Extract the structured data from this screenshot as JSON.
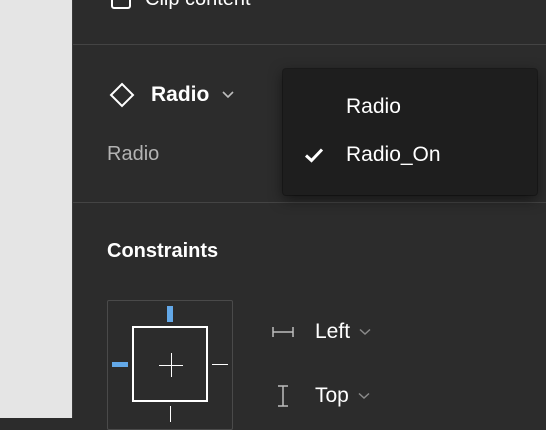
{
  "layer": {
    "clip_content_label": "Clip content"
  },
  "component": {
    "name": "Radio",
    "property_label": "Radio",
    "icon": "diamond-icon"
  },
  "variant_dropdown": {
    "items": [
      {
        "label": "Radio",
        "checked": false
      },
      {
        "label": "Radio_On",
        "checked": true
      }
    ]
  },
  "constraints": {
    "title": "Constraints",
    "horizontal": "Left",
    "vertical": "Top",
    "accent_color": "#63a8e8"
  }
}
